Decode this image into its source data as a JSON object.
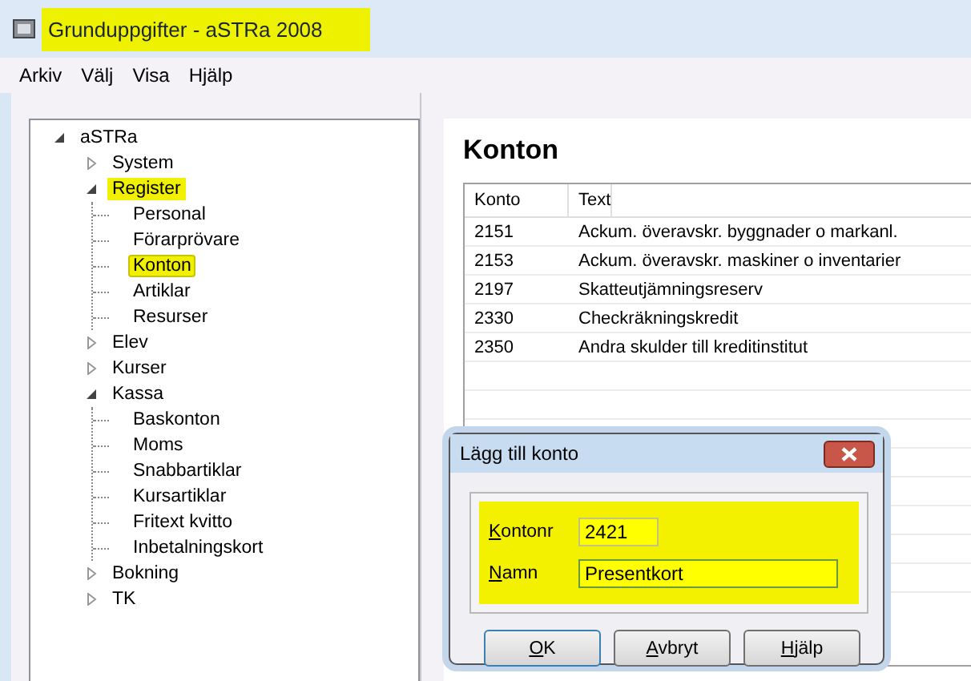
{
  "window": {
    "title": "Grunduppgifter - aSTRa 2008",
    "title_highlighted": true
  },
  "menu": [
    "Arkiv",
    "Välj",
    "Visa",
    "Hjälp"
  ],
  "tree": [
    {
      "label": "aSTRa",
      "expanded": true,
      "selected": false,
      "highlighted": false,
      "children": [
        {
          "label": "System",
          "expanded": false,
          "selected": false,
          "highlighted": false
        },
        {
          "label": "Register",
          "expanded": true,
          "selected": false,
          "highlighted": true,
          "children": [
            {
              "label": "Personal",
              "selected": false,
              "highlighted": false
            },
            {
              "label": "Förarprövare",
              "selected": false,
              "highlighted": false
            },
            {
              "label": "Konton",
              "selected": true,
              "highlighted": true
            },
            {
              "label": "Artiklar",
              "selected": false,
              "highlighted": false
            },
            {
              "label": "Resurser",
              "selected": false,
              "highlighted": false
            }
          ]
        },
        {
          "label": "Elev",
          "expanded": false,
          "selected": false,
          "highlighted": false
        },
        {
          "label": "Kurser",
          "expanded": false,
          "selected": false,
          "highlighted": false
        },
        {
          "label": "Kassa",
          "expanded": true,
          "selected": false,
          "highlighted": false,
          "children": [
            {
              "label": "Baskonton",
              "selected": false,
              "highlighted": false
            },
            {
              "label": "Moms",
              "selected": false,
              "highlighted": false
            },
            {
              "label": "Snabbartiklar",
              "selected": false,
              "highlighted": false
            },
            {
              "label": "Kursartiklar",
              "selected": false,
              "highlighted": false
            },
            {
              "label": "Fritext kvitto",
              "selected": false,
              "highlighted": false
            },
            {
              "label": "Inbetalningskort",
              "selected": false,
              "highlighted": false
            }
          ]
        },
        {
          "label": "Bokning",
          "expanded": false,
          "selected": false,
          "highlighted": false
        },
        {
          "label": "TK",
          "expanded": false,
          "selected": false,
          "highlighted": false
        }
      ]
    }
  ],
  "content": {
    "heading": "Konton",
    "table": {
      "columns": [
        "Konto",
        "Text"
      ],
      "rows": [
        [
          "2151",
          "Ackum. överavskr. byggnader o markanl."
        ],
        [
          "2153",
          "Ackum. överavskr. maskiner o inventarier"
        ],
        [
          "2197",
          "Skatteutjämningsreserv"
        ],
        [
          "2330",
          "Checkräkningskredit"
        ],
        [
          "2350",
          "Andra skulder till kreditinstitut"
        ]
      ]
    }
  },
  "dialog": {
    "title": "Lägg till konto",
    "fields_highlighted": true,
    "fields": [
      {
        "label": "Kontonr",
        "value": "2421"
      },
      {
        "label": "Namn",
        "value": "Presentkort"
      }
    ],
    "buttons": [
      "OK",
      "Avbryt",
      "Hjälp"
    ]
  }
}
